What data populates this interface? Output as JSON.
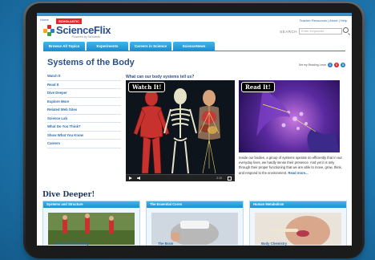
{
  "header": {
    "home_link": "Home",
    "brand_badge": "SCHOLASTIC",
    "logo_text": "ScienceFlix",
    "logo_tagline": "Powered by Scholastic",
    "top_links": "Teacher Resources | About | Help",
    "search_label": "SEARCH",
    "search_placeholder": "Enter Keywords"
  },
  "nav": {
    "tabs": [
      {
        "label": "Browse All Topics"
      },
      {
        "label": "Experiments"
      },
      {
        "label": "Careers in Science"
      },
      {
        "label": "ScienceNews"
      }
    ]
  },
  "page": {
    "title": "Systems of the Body",
    "reading_level_label": "Set my Reading Level",
    "reading_levels": [
      "1",
      "2",
      "3"
    ],
    "question": "What can our body systems tell us?"
  },
  "sidebar": {
    "items": [
      {
        "label": "Watch It"
      },
      {
        "label": "Read It"
      },
      {
        "label": "Dive Deeper"
      },
      {
        "label": "Explore More"
      },
      {
        "label": "Related Web Sites"
      },
      {
        "label": "Science Lab"
      },
      {
        "label": "What Do You Think?"
      },
      {
        "label": "Show What You Know"
      },
      {
        "label": "Careers"
      }
    ]
  },
  "video": {
    "badge": "Watch It!",
    "time": "2:10"
  },
  "read_it": {
    "badge": "Read It!",
    "paragraph": "Inside our bodies, a group of systems operate so efficiently that in our everyday lives, we hardly sense their presence. And yet it is only through their proper functioning that we are able to move, grow, think, and respond to the environment.",
    "more_link": "Read more..."
  },
  "dive_deeper": {
    "heading": "Dive Deeper!",
    "cards": [
      {
        "title": "Systems and Structure",
        "caption": "Structure of the Body"
      },
      {
        "title": "The Essential Cores",
        "caption": "The Brain"
      },
      {
        "title": "Human Metabolism",
        "caption": "Body Chemistry"
      }
    ]
  },
  "colors": {
    "background": "#1f7fb8",
    "accent": "#1e8fcf",
    "title": "#2b4f8e",
    "link": "#2a6db0",
    "brand_red": "#e3252a"
  }
}
